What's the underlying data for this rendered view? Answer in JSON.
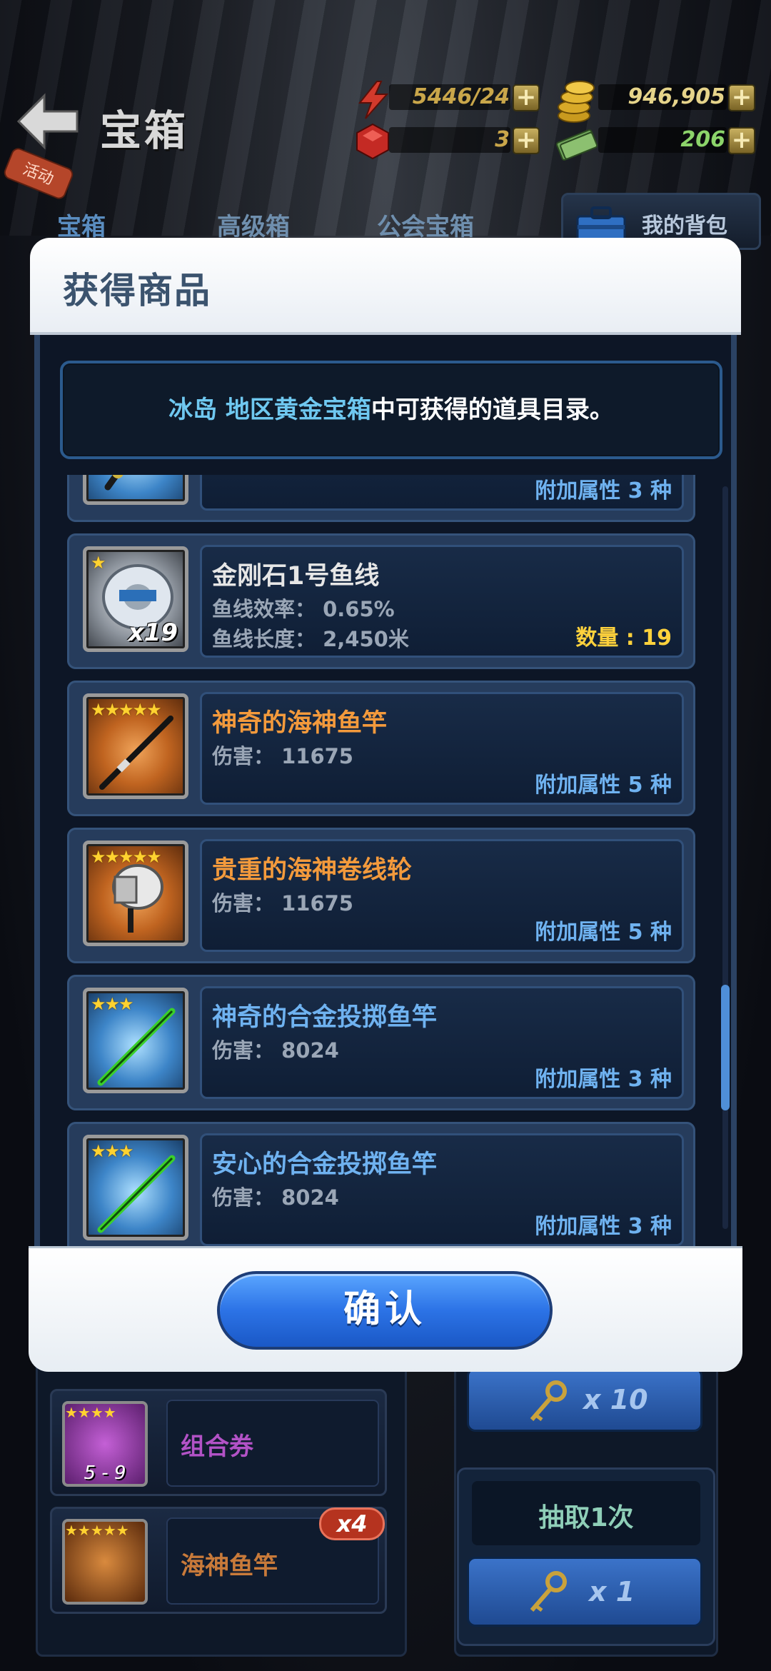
{
  "header": {
    "title": "宝箱",
    "event_tag": "活动",
    "resources": {
      "energy": "5446/24",
      "coins": "946,905",
      "gems": "3",
      "cash": "206"
    }
  },
  "tabs": [
    "宝箱",
    "高级箱",
    "公会宝箱"
  ],
  "bag_button": "我的背包",
  "modal": {
    "title": "获得商品",
    "info_part1": "冰岛 地区黄金宝箱",
    "info_part2": "中可获得的道具目录。",
    "items": [
      {
        "name": "",
        "attr": "附加属性 3 种",
        "thumb": "rod-blue-icon"
      },
      {
        "name": "金刚石1号鱼线",
        "stat1": "鱼线效率： 0.65%",
        "stat2": "鱼线长度： 2,450米",
        "count": "数量 : 19",
        "qty_overlay": "x19",
        "stars": "★",
        "name_color": "#e6e6e6",
        "thumb": "fishing-line-icon"
      },
      {
        "name": "神奇的海神鱼竿",
        "stat1": "伤害： 11675",
        "attr": "附加属性 5 种",
        "stars": "★★★★★",
        "name_color": "#f39a3c",
        "thumb": "rod-orange-icon"
      },
      {
        "name": "贵重的海神卷线轮",
        "stat1": "伤害： 11675",
        "attr": "附加属性 5 种",
        "stars": "★★★★★",
        "name_color": "#f39a3c",
        "thumb": "reel-icon"
      },
      {
        "name": "神奇的合金投掷鱼竿",
        "stat1": "伤害： 8024",
        "attr": "附加属性 3 种",
        "stars": "★★★",
        "name_color": "#6fb2f0",
        "thumb": "rod-green-icon"
      },
      {
        "name": "安心的合金投掷鱼竿",
        "stat1": "伤害： 8024",
        "attr": "附加属性 3 种",
        "stars": "★★★",
        "name_color": "#6fb2f0",
        "thumb": "rod-green-icon"
      }
    ],
    "confirm": "确认"
  },
  "background": {
    "list": [
      {
        "label": "组合券",
        "sub": "5 - 9",
        "color": "#b252c6"
      },
      {
        "label": "海神鱼竿",
        "badge": "x4",
        "color": "#c87a3a"
      }
    ],
    "draw_once": "抽取1次",
    "key_x10": "x 10",
    "key_x1": "x 1"
  },
  "colors": {
    "accent_blue": "#2c73e6",
    "legendary_orange": "#f39a3c",
    "rare_blue": "#6fb2f0",
    "count_yellow": "#ffd23c"
  }
}
